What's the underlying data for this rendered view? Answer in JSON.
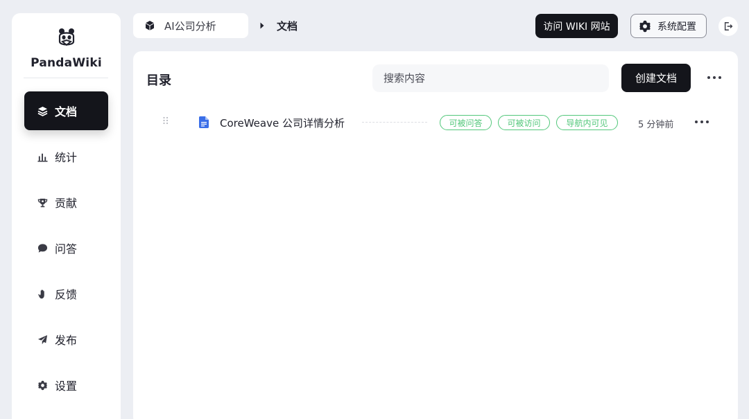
{
  "app": {
    "name": "PandaWiki"
  },
  "sidebar": {
    "items": [
      {
        "label": "文档",
        "icon": "layers-icon",
        "active": true
      },
      {
        "label": "统计",
        "icon": "bar-chart-icon",
        "active": false
      },
      {
        "label": "贡献",
        "icon": "trophy-icon",
        "active": false
      },
      {
        "label": "问答",
        "icon": "chat-bubble-icon",
        "active": false
      },
      {
        "label": "反馈",
        "icon": "hand-icon",
        "active": false
      },
      {
        "label": "发布",
        "icon": "paper-plane-icon",
        "active": false
      },
      {
        "label": "设置",
        "icon": "gear-icon",
        "active": false
      }
    ]
  },
  "header": {
    "kb_name": "AI公司分析",
    "current": "文档",
    "visit_wiki_label": "访问 WIKI 网站",
    "config_label": "系统配置"
  },
  "main": {
    "title": "目录",
    "search_placeholder": "搜索内容",
    "create_label": "创建文档",
    "documents": [
      {
        "name": "CoreWeave 公司详情分析",
        "tags": [
          "可被问答",
          "可被访问",
          "导航内可见"
        ],
        "updated": "5 分钟前"
      }
    ]
  },
  "colors": {
    "accent_dark": "#14151b",
    "tag_green": "#52c77a",
    "doc_blue": "#3a6ee8",
    "page_bg": "#eceef3"
  }
}
